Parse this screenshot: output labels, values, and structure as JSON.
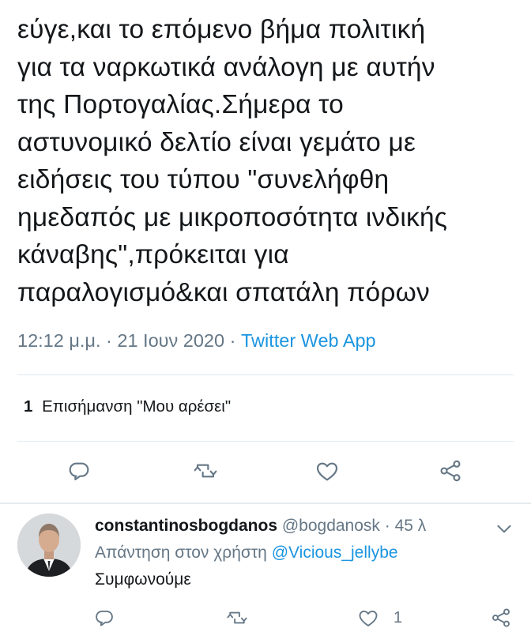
{
  "tweet": {
    "lines": [
      "εύγε,και το επόμενο βήμα πολιτική",
      "για τα ναρκωτικά ανάλογη με αυτήν",
      "της Πορτογαλίας.Σήμερα το",
      "αστυνομικό δελτίο είναι γεμάτο με",
      "ειδήσεις του τύπου \"συνελήφθη",
      "ημεδαπός με μικροποσότητα ινδικής",
      "κάναβης\",πρόκειται για",
      "παραλογισμό&και σπατάλη πόρων"
    ],
    "time": "12:12 μ.μ.",
    "separator": "·",
    "date": "21 Ιουν 2020",
    "source": "Twitter Web App",
    "like_count": "1",
    "like_label": "Επισήμανση \"Μου αρέσει\""
  },
  "actions": {
    "icons": [
      "reply-icon",
      "retweet-icon",
      "like-icon",
      "share-icon"
    ]
  },
  "reply": {
    "display_name": "constantinosbogdanos",
    "handle": "@bogdanosk",
    "time_ago": "45 λ",
    "replying_prefix": "Απάντηση στον χρήστη",
    "replying_to": "@Vicious_jellybe",
    "text": "Συμφωνούμε",
    "like_count": "1"
  },
  "colors": {
    "text": "#14171a",
    "secondary": "#657786",
    "link": "#1b95e0",
    "divider": "#e1e8ed"
  }
}
